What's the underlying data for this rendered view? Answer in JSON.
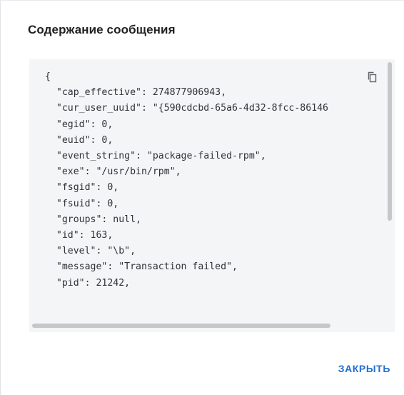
{
  "dialog": {
    "title": "Содержание сообщения",
    "close_label": "ЗАКРЫТЬ",
    "copy_icon": "copy-icon",
    "code_lines": [
      "{",
      "  \"cap_effective\": 274877906943,",
      "  \"cur_user_uuid\": \"{590cdcbd-65a6-4d32-8fcc-86146",
      "  \"egid\": 0,",
      "  \"euid\": 0,",
      "  \"event_string\": \"package-failed-rpm\",",
      "  \"exe\": \"/usr/bin/rpm\",",
      "  \"fsgid\": 0,",
      "  \"fsuid\": 0,",
      "  \"groups\": null,",
      "  \"id\": 163,",
      "  \"level\": \"\\b\",",
      "  \"message\": \"Transaction failed\",",
      "  \"pid\": 21242,"
    ]
  },
  "colors": {
    "accent": "#1f6fd1",
    "code_background": "#f4f5f7"
  }
}
